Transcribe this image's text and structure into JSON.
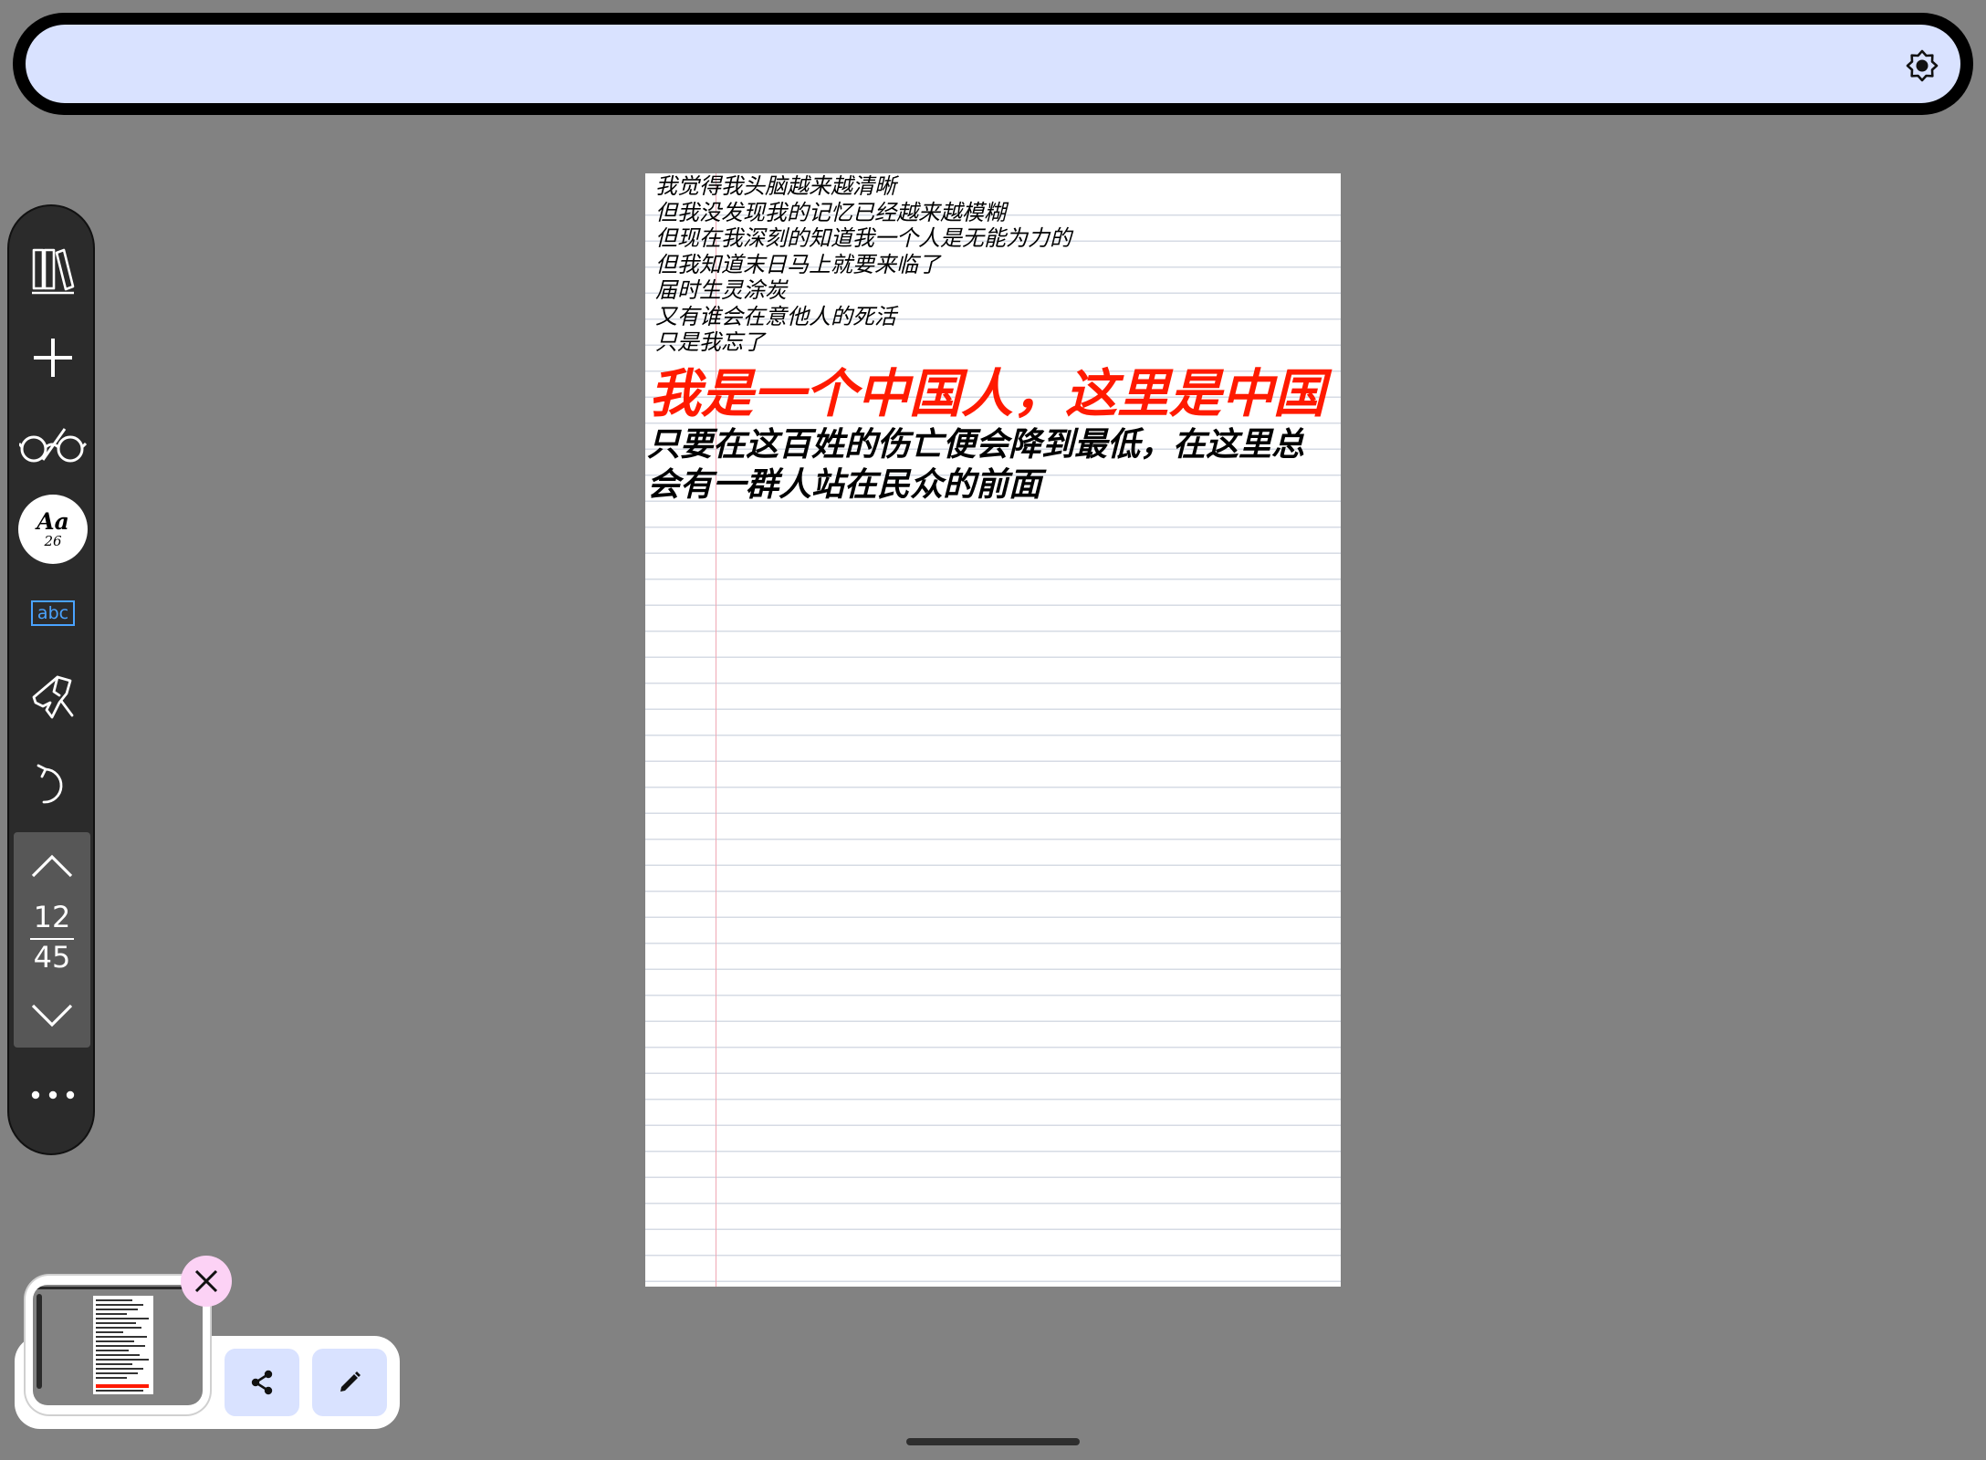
{
  "toolbar": {
    "font_button": {
      "label": "Aa",
      "size": "26"
    },
    "text_box_label": "abc",
    "page_current": "12",
    "page_total": "45"
  },
  "note": {
    "lines": [
      "我觉得我头脑越来越清晰",
      "但我没发现我的记忆已经越来越模糊",
      "但现在我深刻的知道我一个人是无能为力的",
      "但我知道末日马上就要来临了",
      "届时生灵涂炭",
      "又有谁会在意他人的死活",
      "只是我忘了"
    ],
    "title": "我是一个中国人，这里是中国",
    "body": "只要在这百姓的伤亡便会降到最低，在这里总会有一群人站在民众的前面"
  },
  "colors": {
    "background": "#828282",
    "top_bar": "#d9e2ff",
    "toolbar": "#2b2b2b",
    "title_text": "#ff1a00",
    "close_button": "#fcd2f5",
    "abc_accent": "#4aa3ff"
  },
  "icons": {
    "library": "library-icon",
    "add": "plus-icon",
    "read_mode": "glasses-icon",
    "handwriting": "hand-pen-icon",
    "undo": "undo-icon",
    "page_up": "chevron-up-icon",
    "page_down": "chevron-down-icon",
    "more": "more-icon",
    "brightness": "brightness-icon",
    "close": "close-icon",
    "share": "share-icon",
    "edit": "pencil-icon"
  }
}
